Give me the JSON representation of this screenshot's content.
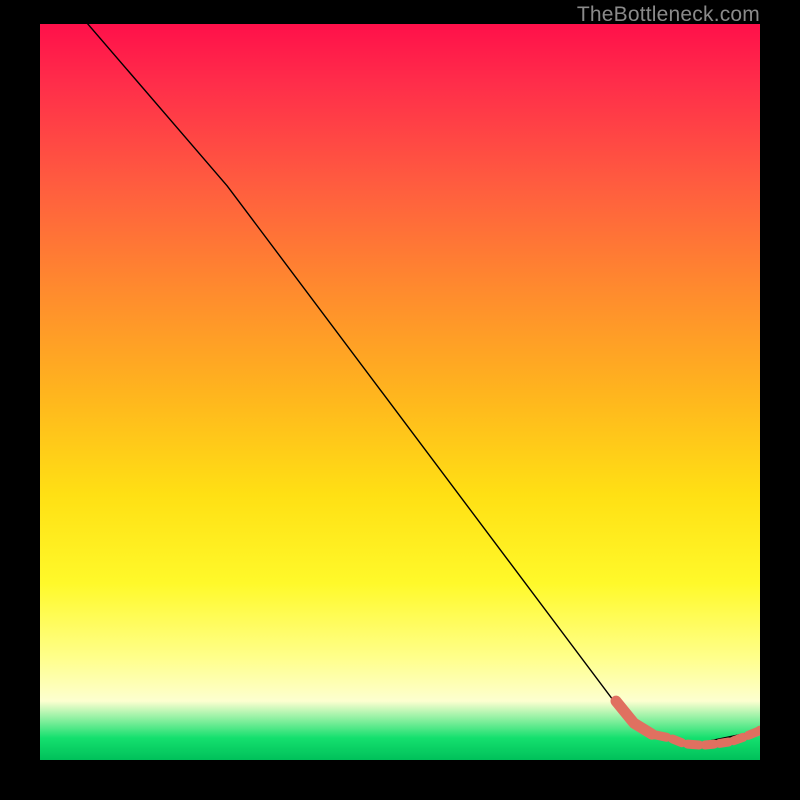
{
  "watermark": "TheBottleneck.com",
  "chart_data": {
    "type": "line",
    "title": "",
    "xlabel": "",
    "ylabel": "",
    "xlim": [
      0,
      100
    ],
    "ylim": [
      0,
      100
    ],
    "grid": false,
    "series": [
      {
        "name": "curve",
        "color": "#000000",
        "linewidth": 1.4,
        "x": [
          4,
          26,
          82,
          90,
          100
        ],
        "y": [
          103,
          78,
          5,
          2,
          4
        ]
      },
      {
        "name": "trough-highlight",
        "color": "#e07060",
        "style": "dashed-markers",
        "x": [
          80,
          82.5,
          85,
          87.5,
          89.5,
          92,
          94,
          96,
          98,
          100
        ],
        "y": [
          8,
          5,
          3.5,
          3,
          2.2,
          2,
          2.2,
          2.5,
          3.2,
          4
        ]
      }
    ]
  }
}
